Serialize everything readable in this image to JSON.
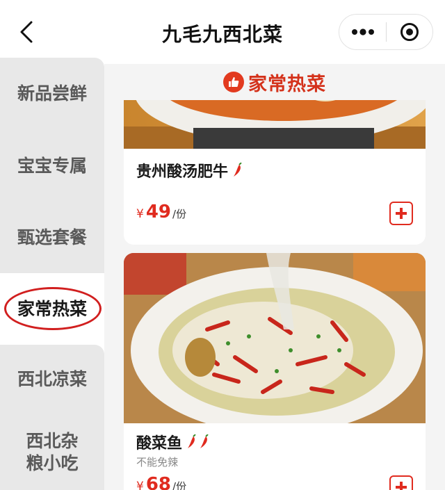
{
  "header": {
    "title": "九毛九西北菜",
    "back_icon": "chevron-left-icon",
    "more_icon": "more-dots-icon",
    "close_icon": "target-circle-icon"
  },
  "sidebar": {
    "items": [
      {
        "label": "新品尝鲜",
        "active": false
      },
      {
        "label": "宝宝专属",
        "active": false
      },
      {
        "label": "甄选套餐",
        "active": false
      },
      {
        "label": "家常热菜",
        "active": true
      },
      {
        "label": "西北凉菜",
        "active": false
      },
      {
        "label": "西北杂粮小吃",
        "active": false
      }
    ]
  },
  "section": {
    "title": "家常热菜",
    "icon": "thumbs-up-icon"
  },
  "dishes": [
    {
      "name": "贵州酸汤肥牛",
      "spice_icons": 1,
      "currency": "¥",
      "price": "49",
      "unit": "/份",
      "note": ""
    },
    {
      "name": "酸菜鱼",
      "spice_icons": 2,
      "currency": "¥",
      "price": "68",
      "unit": "/份",
      "note": "不能免辣"
    }
  ],
  "colors": {
    "accent": "#e02b1f",
    "sidebar_bg": "#e8e8e8",
    "highlight_circle": "#d11f1f"
  }
}
